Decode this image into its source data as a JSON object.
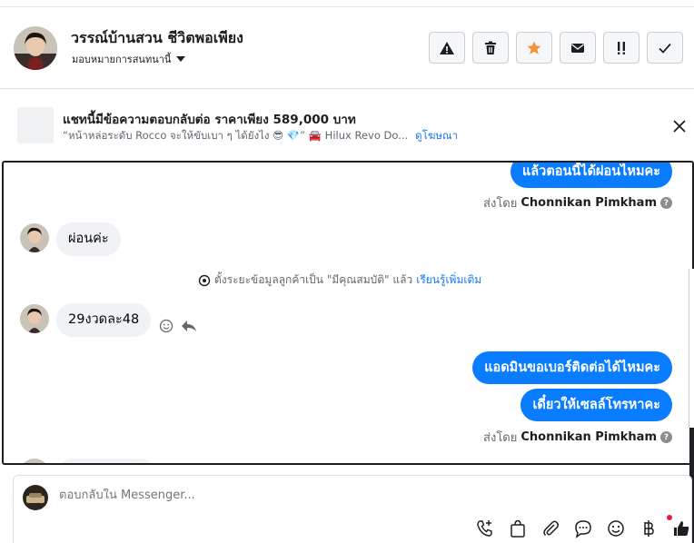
{
  "header": {
    "contact_name": "วรรณ์บ้านสวน ชีวิตพอเพียง",
    "assign_label": "มอบหมายการสนทนานี้",
    "buttons": [
      {
        "name": "warning-button",
        "icon": "warning-icon"
      },
      {
        "name": "delete-button",
        "icon": "trash-icon"
      },
      {
        "name": "star-button",
        "icon": "star-icon"
      },
      {
        "name": "mark-unread-button",
        "icon": "envelope-icon"
      },
      {
        "name": "follow-up-button",
        "icon": "double-exclamation-icon"
      },
      {
        "name": "done-button",
        "icon": "checkmark-icon"
      }
    ]
  },
  "ad": {
    "title": "แชทนี้มีข้อความตอบกลับต่อ ราคาเพียง 589,000 บาท",
    "snippet": "“หน้าหล่อระดับ Rocco จะให้ขับเบา ๆ ได้ยังไง 😎 💎” 🚘 Hilux Revo Do...",
    "link_label": "ดูโฆษณา"
  },
  "chat": {
    "messages": [
      {
        "direction": "out",
        "text": "แล้วตอนนี้ได้ผ่อนไหมคะ"
      },
      {
        "direction": "in",
        "text": "ผ่อนค่ะ"
      },
      {
        "direction": "in",
        "text": "29งวดละ48"
      },
      {
        "direction": "out",
        "text": "แอดมินขอเบอร์ติดต่อได้ไหมคะ"
      },
      {
        "direction": "out",
        "text": "เดี๋ยวให้เซลล์โทรหาคะ"
      }
    ],
    "sent_by_prefix": "ส่งโดย",
    "sent_by_name": "Chonnikan Pimkham",
    "info_symbol": "?",
    "system_note": "ตั้งระยะข้อมูลลูกค้าเป็น \"มีคุณสมบัติ\" แล้ว",
    "system_link": "เรียนรู้เพิ่มเติม"
  },
  "composer": {
    "placeholder": "ตอบกลับใน Messenger..."
  },
  "colors": {
    "accent": "#0a7cff",
    "star": "#f7923a",
    "link": "#1877f2",
    "notification": "#e41e3f"
  }
}
